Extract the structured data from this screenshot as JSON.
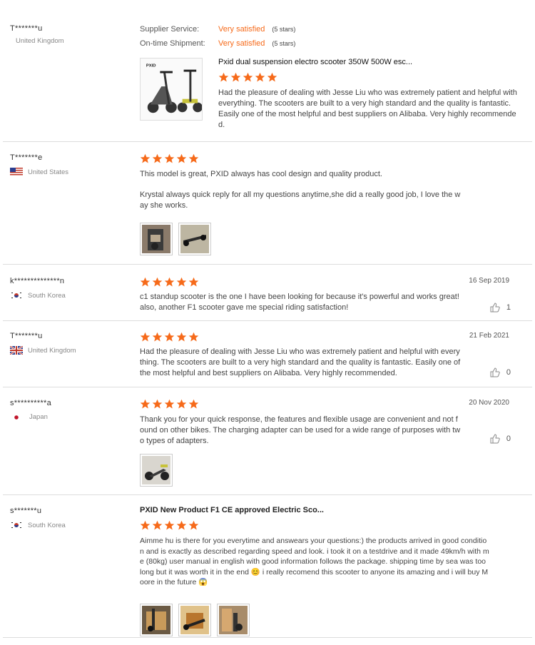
{
  "colors": {
    "accent": "#f66a1a",
    "star": "#f66a1a",
    "border": "#dddddd"
  },
  "reviews": [
    {
      "user": "T*******u",
      "country": "United Kingdom",
      "supplier_service_label": "Supplier Service:",
      "supplier_service_value": "Very satisfied",
      "supplier_service_stars": "(5 stars)",
      "shipment_label": "On-time Shipment:",
      "shipment_value": "Very satisfied",
      "shipment_stars": "(5 stars)",
      "product_title": "Pxid dual suspension electro scooter 350W 500W esc...",
      "product_image_text": "PXID",
      "rating": 5,
      "text": "Had the pleasure of dealing with Jesse Liu who was extremely patient and helpful with everything. The scooters are built to a very high standard and the quality is fantastic. Easily one of the most helpful and best suppliers on Alibaba. Very highly recommended."
    },
    {
      "user": "T*******e",
      "country": "United States",
      "flag_icon": "us-flag-icon",
      "rating": 5,
      "text1": "This model is great, PXID always has cool design and quality product.",
      "text2": "Krystal always quick reply for all my questions anytime,she did a really good job, I love the way she works."
    },
    {
      "user": "k**************n",
      "country": "South Korea",
      "flag_icon": "kr-flag-icon",
      "rating": 5,
      "date": "16 Sep 2019",
      "text": "c1 standup scooter is the one I have been looking for because it's powerful and works great! also, another F1 scooter gave me special riding satisfaction!",
      "likes": "1"
    },
    {
      "user": "T*******u",
      "country": "United Kingdom",
      "flag_icon": "uk-flag-icon",
      "rating": 5,
      "date": "21 Feb 2021",
      "text": "Had the pleasure of dealing with Jesse Liu who was extremely patient and helpful with everything. The scooters are built to a very high standard and the quality is fantastic. Easily one of the most helpful and best suppliers on Alibaba. Very highly recommended.",
      "likes": "0"
    },
    {
      "user": "s**********a",
      "country": "Japan",
      "flag_icon": "jp-flag-icon",
      "rating": 5,
      "date": "20 Nov 2020",
      "text": "Thank you for your quick response, the features and flexible usage are convenient and not found on other bikes. The charging adapter can be used for a wide range of purposes with two types of adapters.",
      "likes": "0"
    },
    {
      "user": "s*******u",
      "country": "South Korea",
      "flag_icon": "kr-flag-icon",
      "product_title": "PXID New Product F1 CE approved Electric Sco...",
      "rating": 5,
      "text": "Aimme hu is there for you everytime and answears your questions:) the products arrived in good condition and is exactly as described regarding speed and look. i took it on a testdrive and it made 49km/h with me (80kg) user manual in english with good information follows the package. shipping time by sea was too long but it was worth it in the end 😊 i really recomend this scooter to anyone its amazing and i will buy Moore in the future 😱"
    }
  ]
}
